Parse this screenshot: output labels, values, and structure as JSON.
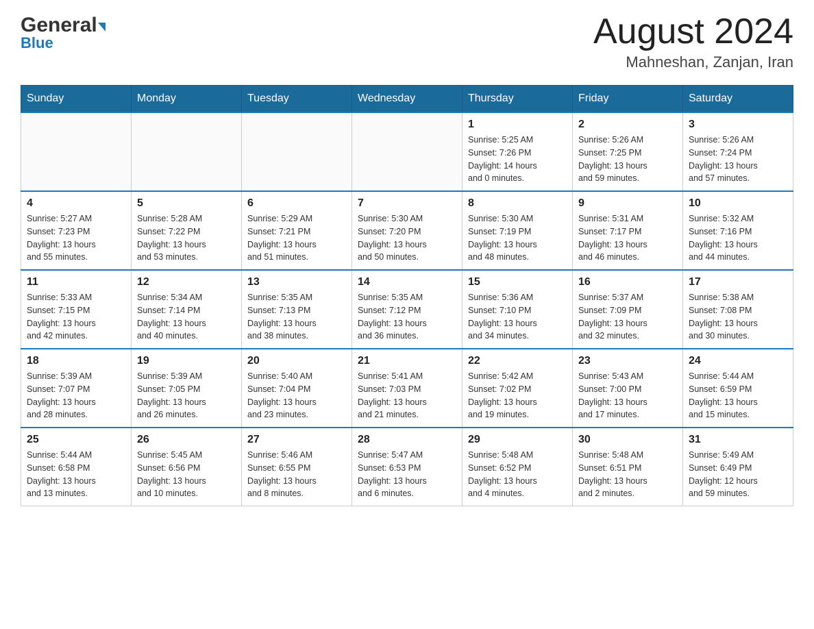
{
  "header": {
    "logo_general": "General",
    "logo_blue": "Blue",
    "month_year": "August 2024",
    "location": "Mahneshan, Zanjan, Iran"
  },
  "days_of_week": [
    "Sunday",
    "Monday",
    "Tuesday",
    "Wednesday",
    "Thursday",
    "Friday",
    "Saturday"
  ],
  "weeks": [
    {
      "cells": [
        {
          "day": "",
          "info": ""
        },
        {
          "day": "",
          "info": ""
        },
        {
          "day": "",
          "info": ""
        },
        {
          "day": "",
          "info": ""
        },
        {
          "day": "1",
          "info": "Sunrise: 5:25 AM\nSunset: 7:26 PM\nDaylight: 14 hours\nand 0 minutes."
        },
        {
          "day": "2",
          "info": "Sunrise: 5:26 AM\nSunset: 7:25 PM\nDaylight: 13 hours\nand 59 minutes."
        },
        {
          "day": "3",
          "info": "Sunrise: 5:26 AM\nSunset: 7:24 PM\nDaylight: 13 hours\nand 57 minutes."
        }
      ]
    },
    {
      "cells": [
        {
          "day": "4",
          "info": "Sunrise: 5:27 AM\nSunset: 7:23 PM\nDaylight: 13 hours\nand 55 minutes."
        },
        {
          "day": "5",
          "info": "Sunrise: 5:28 AM\nSunset: 7:22 PM\nDaylight: 13 hours\nand 53 minutes."
        },
        {
          "day": "6",
          "info": "Sunrise: 5:29 AM\nSunset: 7:21 PM\nDaylight: 13 hours\nand 51 minutes."
        },
        {
          "day": "7",
          "info": "Sunrise: 5:30 AM\nSunset: 7:20 PM\nDaylight: 13 hours\nand 50 minutes."
        },
        {
          "day": "8",
          "info": "Sunrise: 5:30 AM\nSunset: 7:19 PM\nDaylight: 13 hours\nand 48 minutes."
        },
        {
          "day": "9",
          "info": "Sunrise: 5:31 AM\nSunset: 7:17 PM\nDaylight: 13 hours\nand 46 minutes."
        },
        {
          "day": "10",
          "info": "Sunrise: 5:32 AM\nSunset: 7:16 PM\nDaylight: 13 hours\nand 44 minutes."
        }
      ]
    },
    {
      "cells": [
        {
          "day": "11",
          "info": "Sunrise: 5:33 AM\nSunset: 7:15 PM\nDaylight: 13 hours\nand 42 minutes."
        },
        {
          "day": "12",
          "info": "Sunrise: 5:34 AM\nSunset: 7:14 PM\nDaylight: 13 hours\nand 40 minutes."
        },
        {
          "day": "13",
          "info": "Sunrise: 5:35 AM\nSunset: 7:13 PM\nDaylight: 13 hours\nand 38 minutes."
        },
        {
          "day": "14",
          "info": "Sunrise: 5:35 AM\nSunset: 7:12 PM\nDaylight: 13 hours\nand 36 minutes."
        },
        {
          "day": "15",
          "info": "Sunrise: 5:36 AM\nSunset: 7:10 PM\nDaylight: 13 hours\nand 34 minutes."
        },
        {
          "day": "16",
          "info": "Sunrise: 5:37 AM\nSunset: 7:09 PM\nDaylight: 13 hours\nand 32 minutes."
        },
        {
          "day": "17",
          "info": "Sunrise: 5:38 AM\nSunset: 7:08 PM\nDaylight: 13 hours\nand 30 minutes."
        }
      ]
    },
    {
      "cells": [
        {
          "day": "18",
          "info": "Sunrise: 5:39 AM\nSunset: 7:07 PM\nDaylight: 13 hours\nand 28 minutes."
        },
        {
          "day": "19",
          "info": "Sunrise: 5:39 AM\nSunset: 7:05 PM\nDaylight: 13 hours\nand 26 minutes."
        },
        {
          "day": "20",
          "info": "Sunrise: 5:40 AM\nSunset: 7:04 PM\nDaylight: 13 hours\nand 23 minutes."
        },
        {
          "day": "21",
          "info": "Sunrise: 5:41 AM\nSunset: 7:03 PM\nDaylight: 13 hours\nand 21 minutes."
        },
        {
          "day": "22",
          "info": "Sunrise: 5:42 AM\nSunset: 7:02 PM\nDaylight: 13 hours\nand 19 minutes."
        },
        {
          "day": "23",
          "info": "Sunrise: 5:43 AM\nSunset: 7:00 PM\nDaylight: 13 hours\nand 17 minutes."
        },
        {
          "day": "24",
          "info": "Sunrise: 5:44 AM\nSunset: 6:59 PM\nDaylight: 13 hours\nand 15 minutes."
        }
      ]
    },
    {
      "cells": [
        {
          "day": "25",
          "info": "Sunrise: 5:44 AM\nSunset: 6:58 PM\nDaylight: 13 hours\nand 13 minutes."
        },
        {
          "day": "26",
          "info": "Sunrise: 5:45 AM\nSunset: 6:56 PM\nDaylight: 13 hours\nand 10 minutes."
        },
        {
          "day": "27",
          "info": "Sunrise: 5:46 AM\nSunset: 6:55 PM\nDaylight: 13 hours\nand 8 minutes."
        },
        {
          "day": "28",
          "info": "Sunrise: 5:47 AM\nSunset: 6:53 PM\nDaylight: 13 hours\nand 6 minutes."
        },
        {
          "day": "29",
          "info": "Sunrise: 5:48 AM\nSunset: 6:52 PM\nDaylight: 13 hours\nand 4 minutes."
        },
        {
          "day": "30",
          "info": "Sunrise: 5:48 AM\nSunset: 6:51 PM\nDaylight: 13 hours\nand 2 minutes."
        },
        {
          "day": "31",
          "info": "Sunrise: 5:49 AM\nSunset: 6:49 PM\nDaylight: 12 hours\nand 59 minutes."
        }
      ]
    }
  ]
}
